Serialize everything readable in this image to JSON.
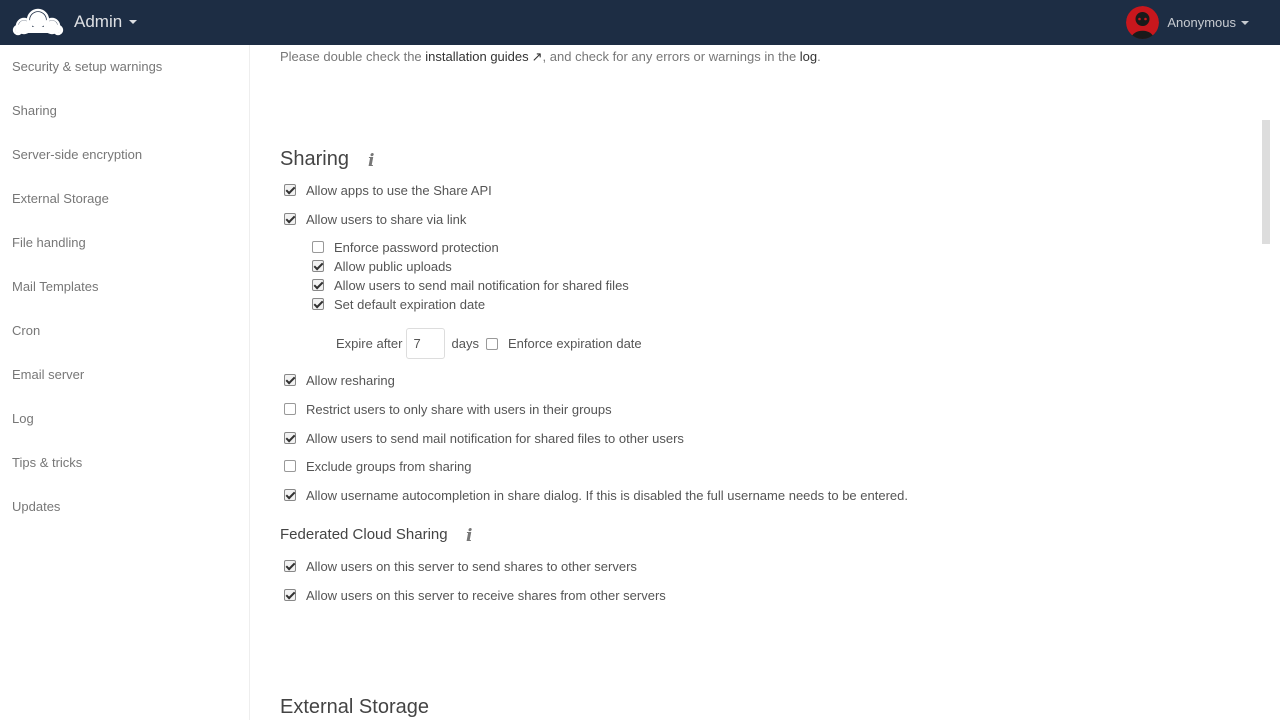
{
  "header": {
    "app_name": "Admin",
    "user_name": "Anonymous",
    "bg_color": "#1d2d44"
  },
  "sidebar": {
    "items": [
      {
        "label": "Security & setup warnings"
      },
      {
        "label": "Sharing"
      },
      {
        "label": "Server-side encryption"
      },
      {
        "label": "External Storage"
      },
      {
        "label": "File handling"
      },
      {
        "label": "Mail Templates"
      },
      {
        "label": "Cron"
      },
      {
        "label": "Email server"
      },
      {
        "label": "Log"
      },
      {
        "label": "Tips & tricks"
      },
      {
        "label": "Updates"
      }
    ]
  },
  "notice": {
    "prefix": "Please double check the ",
    "link_guides": "installation guides",
    "middle": ", and check for any errors or warnings in the ",
    "link_log": "log",
    "suffix": "."
  },
  "sharing": {
    "title": "Sharing",
    "info_icon": "i",
    "options": {
      "share_api": {
        "label": "Allow apps to use the Share API",
        "checked": true
      },
      "share_link": {
        "label": "Allow users to share via link",
        "checked": true
      },
      "enforce_password": {
        "label": "Enforce password protection",
        "checked": false
      },
      "public_uploads": {
        "label": "Allow public uploads",
        "checked": true
      },
      "mail_notification": {
        "label": "Allow users to send mail notification for shared files",
        "checked": true
      },
      "default_expiration": {
        "label": "Set default expiration date",
        "checked": true
      },
      "resharing": {
        "label": "Allow resharing",
        "checked": true
      },
      "restrict_groups": {
        "label": "Restrict users to only share with users in their groups",
        "checked": false
      },
      "mail_notification_other": {
        "label": "Allow users to send mail notification for shared files to other users",
        "checked": true
      },
      "exclude_groups": {
        "label": "Exclude groups from sharing",
        "checked": false
      },
      "autocomplete": {
        "label": "Allow username autocompletion in share dialog. If this is disabled the full username needs to be entered.",
        "checked": true
      }
    },
    "expire": {
      "prefix": "Expire after",
      "value": "7",
      "suffix": "days",
      "enforce_label": "Enforce expiration date",
      "enforce_checked": false
    }
  },
  "federated": {
    "title": "Federated Cloud Sharing",
    "info_icon": "i",
    "options": {
      "send": {
        "label": "Allow users on this server to send shares to other servers",
        "checked": true
      },
      "receive": {
        "label": "Allow users on this server to receive shares from other servers",
        "checked": true
      }
    }
  },
  "external_storage": {
    "title": "External Storage"
  }
}
